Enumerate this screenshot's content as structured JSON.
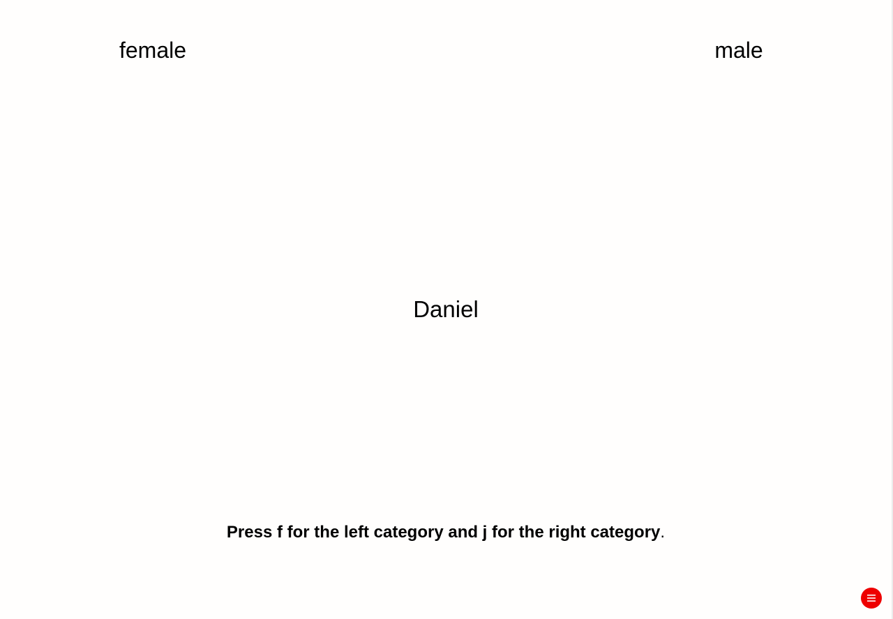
{
  "categories": {
    "left": "female",
    "right": "male"
  },
  "stimulus": {
    "word": "Daniel"
  },
  "instruction": {
    "bold_text": "Press f for the left category and j for the right category",
    "trailing_text": "."
  },
  "menu": {
    "icon": "hamburger-menu-icon",
    "color": "#ee0000"
  }
}
